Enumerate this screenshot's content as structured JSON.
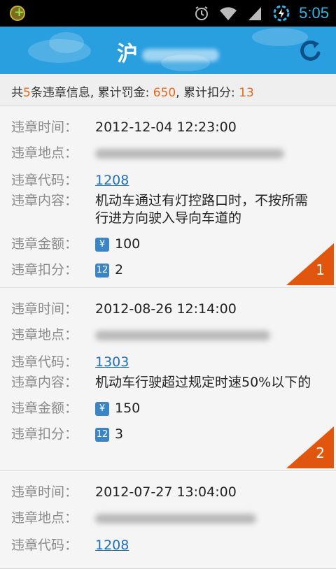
{
  "status_bar": {
    "time": "5:05"
  },
  "header": {
    "province": "沪"
  },
  "summary": {
    "prefix": "共",
    "count": "5",
    "count_suffix": "条违章信息, 累计罚金: ",
    "fine_total": "650",
    "points_label": ", 累计扣分: ",
    "points_total": "13"
  },
  "labels": {
    "time": "违章时间：",
    "location": "违章地点：",
    "code": "违章代码：",
    "content": "违章内容：",
    "fine": "违章金额：",
    "points": "违章扣分："
  },
  "violations": [
    {
      "time": "2012-12-04 12:23:00",
      "code": "1208",
      "content": "机动车通过有灯控路口时，不按所需行进方向驶入导向车道的",
      "fine": "100",
      "points": "2",
      "index": "1"
    },
    {
      "time": "2012-08-26 12:14:00",
      "code": "1303",
      "content": "机动车行驶超过规定时速50%以下的",
      "fine": "150",
      "points": "3",
      "index": "2"
    },
    {
      "time": "2012-07-27 13:04:00",
      "code": "1208",
      "content": "",
      "fine": "",
      "points": "",
      "index": ""
    }
  ],
  "icons": {
    "yuan_icon": "¥",
    "points_icon": "12"
  },
  "colors": {
    "header_bg": "#2a9fe0",
    "accent_orange": "#e0560f",
    "link_blue": "#1f6fba"
  }
}
